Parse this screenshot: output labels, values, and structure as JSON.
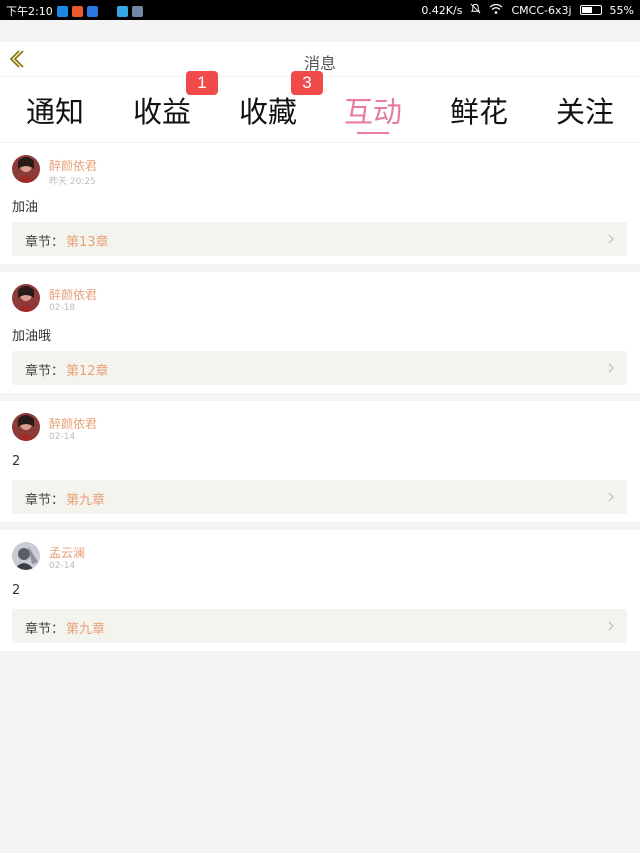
{
  "status": {
    "time": "下午2:10",
    "speed": "0.42K/s",
    "carrier": "CMCC-6x3j",
    "battery": "55%",
    "battery_fraction": 0.55,
    "app_icon_colors": [
      "#1a8ae6",
      "#e85a2d",
      "#2b78e4",
      "#000000",
      "#35a8ea",
      "#6e8aa6"
    ]
  },
  "header": {
    "title": "消息",
    "back_icon": "chevron-left-icon"
  },
  "tabs": [
    {
      "label": "通知"
    },
    {
      "label": "收益",
      "badge": "1"
    },
    {
      "label": "收藏",
      "badge": "3"
    },
    {
      "label": "互动",
      "active": true
    },
    {
      "label": "鲜花"
    },
    {
      "label": "关注"
    }
  ],
  "messages": [
    {
      "user": "醉颜依君",
      "time": "昨天 20:25",
      "content": "加油",
      "chapter_label": "章节：",
      "chapter": "第13章"
    },
    {
      "user": "醉颜依君",
      "time": "02-18",
      "content": "加油哦",
      "chapter_label": "章节：",
      "chapter": "第12章"
    },
    {
      "user": "醉颜依君",
      "time": "02-14",
      "content": "2",
      "chapter_label": "章节：",
      "chapter": "第九章"
    },
    {
      "user": "孟云澜",
      "time": "02-14",
      "content": "2",
      "chapter_label": "章节：",
      "chapter": "第九章"
    }
  ],
  "colors": {
    "accent": "#e77ba4",
    "username": "#e8a07a",
    "badge": "#f04a4a"
  }
}
